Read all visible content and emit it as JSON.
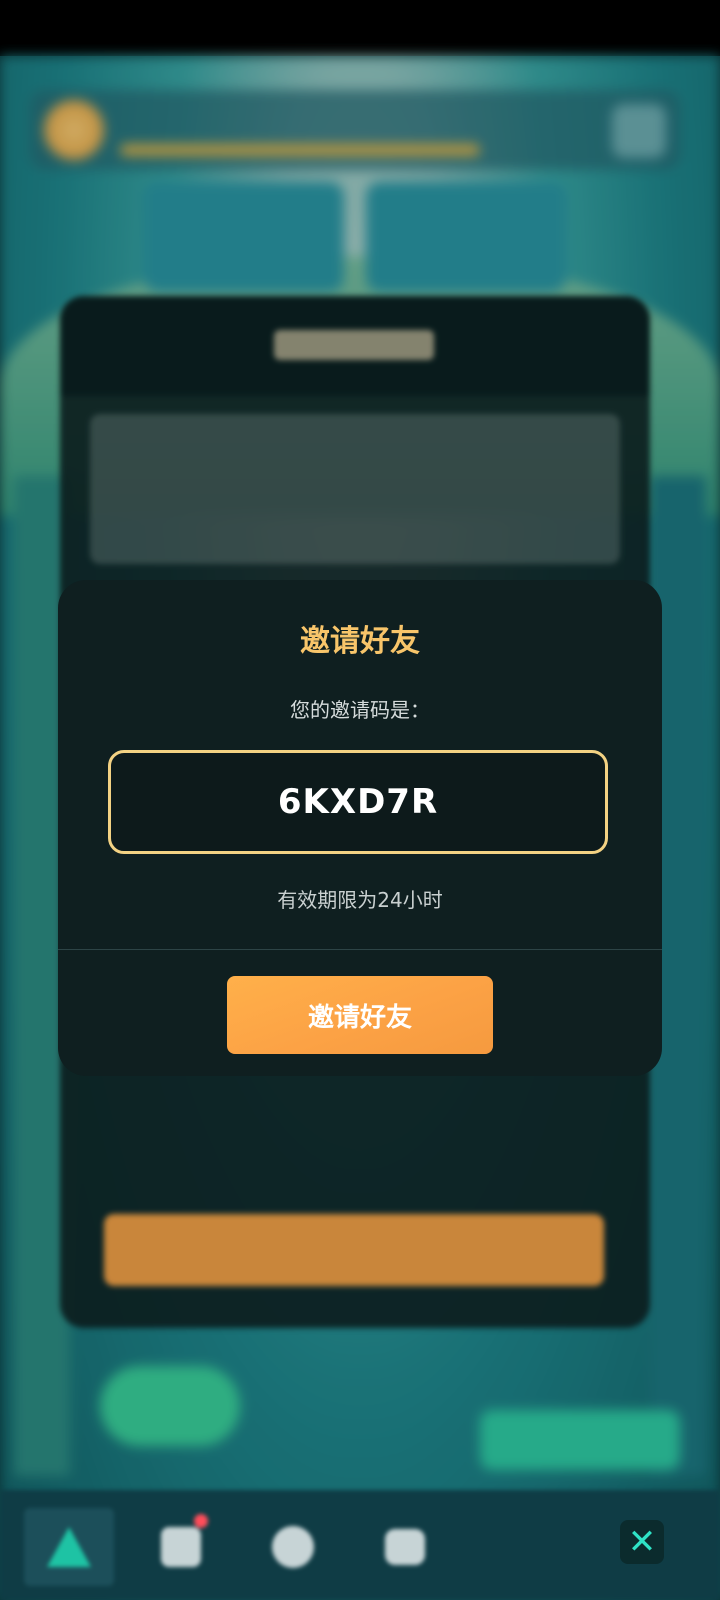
{
  "modal": {
    "title": "邀请好友",
    "code_label": "您的邀请码是：",
    "invite_code": "6KXD7R",
    "validity": "有效期限为24小时",
    "invite_button": "邀请好友"
  },
  "colors": {
    "accent_gold": "#f8c56a",
    "button_orange": "#fca245",
    "modal_bg": "#0f1f20",
    "close_cyan": "#2fe2c6"
  },
  "icons": {
    "close": "close-icon",
    "nav": [
      "triangle-icon",
      "box-icon",
      "circle-icon",
      "heart-icon"
    ]
  },
  "close_glyph": "✕"
}
